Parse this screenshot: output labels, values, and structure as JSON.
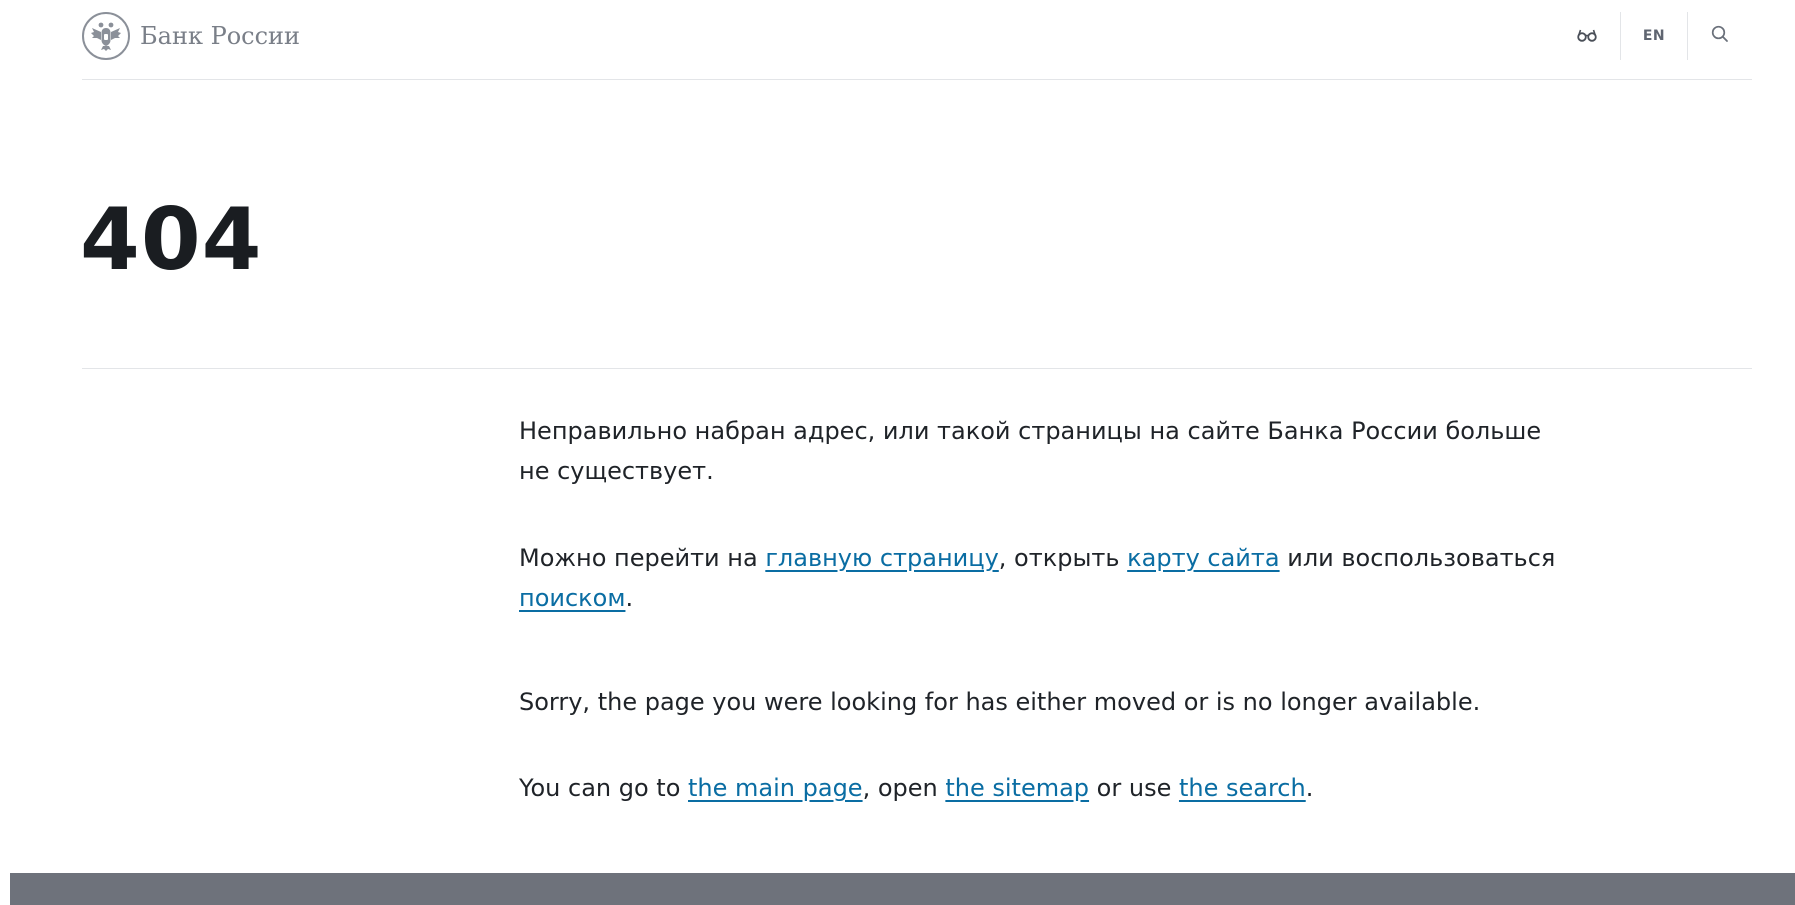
{
  "header": {
    "logo_text": "Банк России",
    "lang_label": "EN",
    "icons": {
      "emblem": "double-headed-eagle-emblem",
      "accessibility": "glasses-icon",
      "search": "search-icon"
    }
  },
  "error": {
    "code": "404"
  },
  "message_ru": {
    "line1": "Неправильно набран адрес, или такой страницы на сайте Банка России больше не существует.",
    "line2_prefix": "Можно перейти на ",
    "main_link": "главную страницу",
    "line2_mid1": ", открыть ",
    "sitemap_link": "карту сайта",
    "line2_mid2": " или воспользоваться ",
    "search_link": "поиском",
    "line2_suffix": "."
  },
  "message_en": {
    "line1": "Sorry, the page you were looking for has either moved or is no longer available.",
    "line2_prefix": "You can go to ",
    "main_link": "the main page",
    "line2_mid1": ", open ",
    "sitemap_link": "the sitemap",
    "line2_mid2": " or use ",
    "search_link": "the search",
    "line2_suffix": "."
  },
  "colors": {
    "link": "#0a6da3",
    "text": "#1f2328",
    "footer": "#6e727b",
    "divider": "#e3e5e8"
  }
}
